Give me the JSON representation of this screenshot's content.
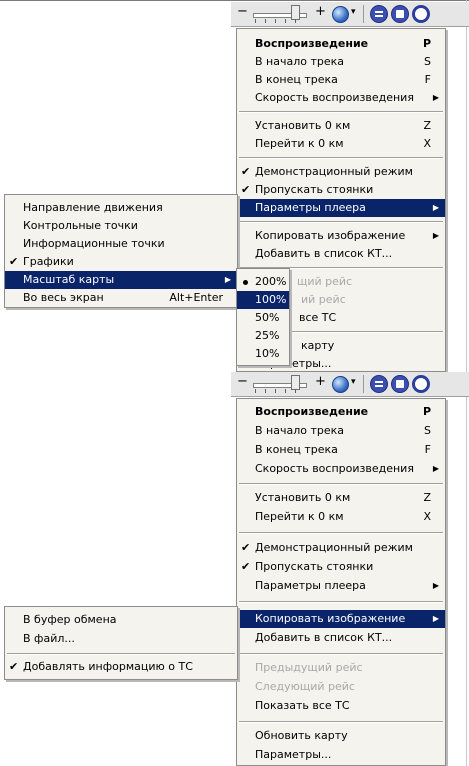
{
  "toolbar": {
    "minus": "−",
    "plus": "+",
    "dropdown": "▾"
  },
  "main_menu_1": {
    "items": [
      {
        "label": "Воспроизведение",
        "shortcut": "P",
        "bold": true
      },
      {
        "label": "В начало трека",
        "shortcut": "S"
      },
      {
        "label": "В конец трека",
        "shortcut": "F"
      },
      {
        "label": "Скорость воспроизведения",
        "submenu": true
      },
      {
        "label": "Установить 0 км",
        "shortcut": "Z"
      },
      {
        "label": "Перейти к 0 км",
        "shortcut": "X"
      },
      {
        "label": "Демонстрационный режим",
        "checked": true
      },
      {
        "label": "Пропускать стоянки",
        "checked": true
      },
      {
        "label": "Параметры плеера",
        "submenu": true,
        "highlighted": true
      },
      {
        "label": "Копировать изображение",
        "submenu": true
      },
      {
        "label": "Добавить в список КТ..."
      },
      {
        "label": "щий рейс",
        "disabled": true
      },
      {
        "label": "ий рейс",
        "disabled": true
      },
      {
        "label": "все ТС"
      },
      {
        "label": "карту"
      },
      {
        "label": "Параметры..."
      }
    ]
  },
  "player_submenu": {
    "items": [
      {
        "label": "Направление движения"
      },
      {
        "label": "Контрольные точки"
      },
      {
        "label": "Информационные точки"
      },
      {
        "label": "Графики",
        "checked": true
      },
      {
        "label": "Масштаб карты",
        "submenu": true,
        "highlighted": true
      },
      {
        "label": "Во весь экран",
        "shortcut": "Alt+Enter"
      }
    ]
  },
  "scale_submenu": {
    "items": [
      {
        "label": "200%",
        "selected": true
      },
      {
        "label": "100%",
        "highlighted": true
      },
      {
        "label": "50%"
      },
      {
        "label": "25%"
      },
      {
        "label": "10%"
      }
    ]
  },
  "main_menu_2": {
    "items": [
      {
        "label": "Воспроизведение",
        "shortcut": "P",
        "bold": true
      },
      {
        "label": "В начало трека",
        "shortcut": "S"
      },
      {
        "label": "В конец трека",
        "shortcut": "F"
      },
      {
        "label": "Скорость воспроизведения",
        "submenu": true
      },
      {
        "label": "Установить 0 км",
        "shortcut": "Z"
      },
      {
        "label": "Перейти к 0 км",
        "shortcut": "X"
      },
      {
        "label": "Демонстрационный режим",
        "checked": true
      },
      {
        "label": "Пропускать стоянки",
        "checked": true
      },
      {
        "label": "Параметры плеера",
        "submenu": true
      },
      {
        "label": "Копировать изображение",
        "submenu": true,
        "highlighted": true
      },
      {
        "label": "Добавить в список КТ..."
      },
      {
        "label": "Предыдущий рейс",
        "disabled": true
      },
      {
        "label": "Следующий рейс",
        "disabled": true
      },
      {
        "label": "Показать все ТС"
      },
      {
        "label": "Обновить карту"
      },
      {
        "label": "Параметры..."
      }
    ]
  },
  "copy_submenu": {
    "items": [
      {
        "label": "В буфер обмена"
      },
      {
        "label": "В файл..."
      },
      {
        "label": "Добавлять информацию о ТС",
        "checked": true
      }
    ]
  },
  "glyphs": {
    "check": "✔",
    "arrow": "▶"
  }
}
